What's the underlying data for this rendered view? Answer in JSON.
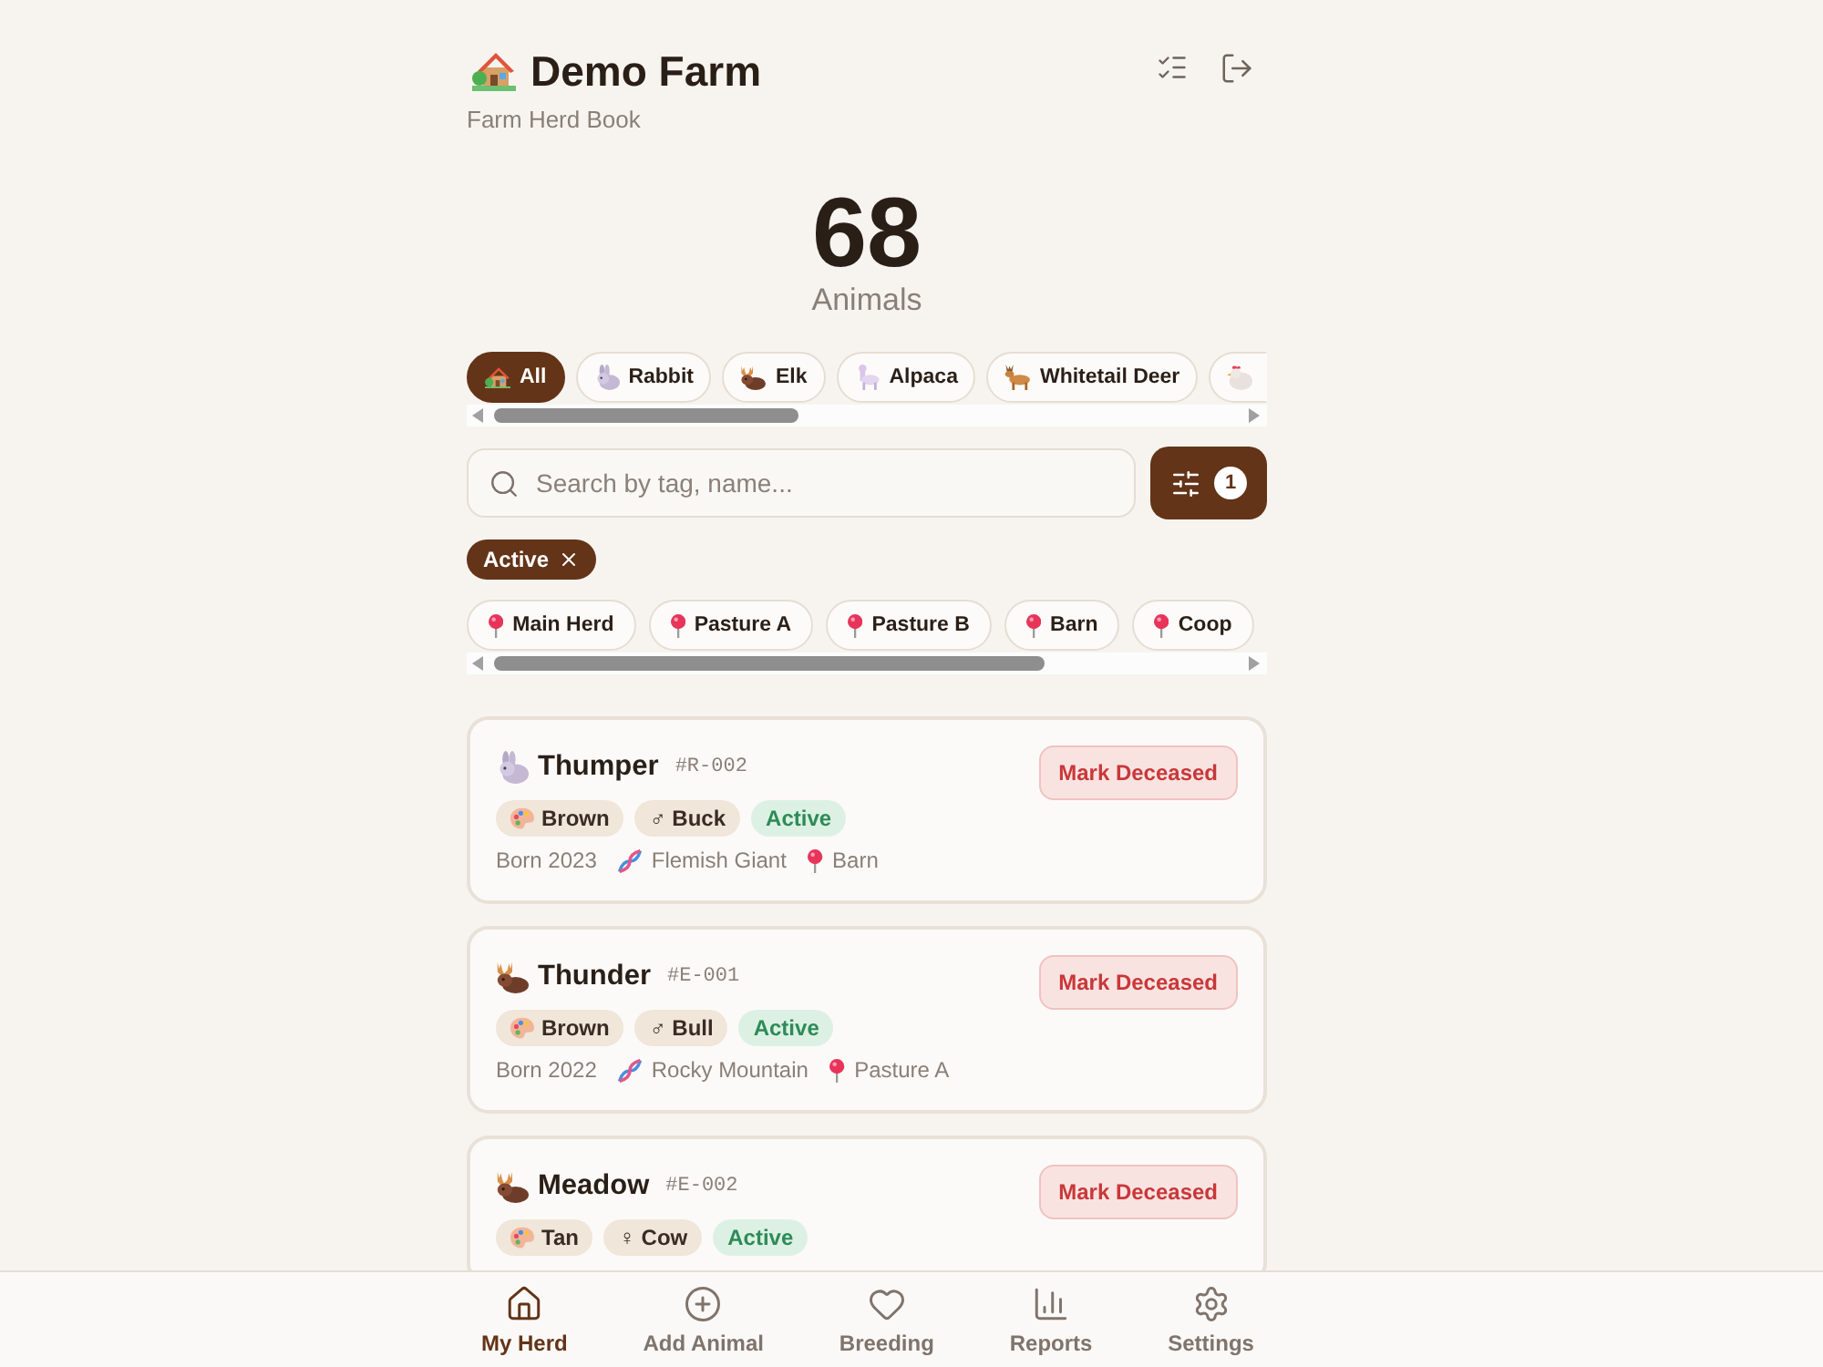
{
  "header": {
    "title": "Demo Farm",
    "subtitle": "Farm Herd Book"
  },
  "summary": {
    "count": "68",
    "label": "Animals"
  },
  "species_filters": [
    {
      "kind": "all",
      "label": "All",
      "selected": true
    },
    {
      "kind": "rabbit",
      "label": "Rabbit",
      "selected": false
    },
    {
      "kind": "elk",
      "label": "Elk",
      "selected": false
    },
    {
      "kind": "alpaca",
      "label": "Alpaca",
      "selected": false
    },
    {
      "kind": "deer",
      "label": "Whitetail Deer",
      "selected": false
    },
    {
      "kind": "chicken",
      "selected": false
    }
  ],
  "search": {
    "placeholder": "Search by tag, name..."
  },
  "filter_button": {
    "badge": "1"
  },
  "active_filters": [
    {
      "label": "Active"
    }
  ],
  "locations": [
    {
      "label": "Main Herd",
      "selected": false
    },
    {
      "label": "Pasture A",
      "selected": false
    },
    {
      "label": "Pasture B",
      "selected": false
    },
    {
      "label": "Barn",
      "selected": false
    },
    {
      "label": "Coop",
      "selected": false
    }
  ],
  "animals": [
    {
      "kind": "rabbit",
      "name": "Thumper",
      "tag": "#R-002",
      "tags": [
        {
          "kind": "color",
          "label": "Brown"
        },
        {
          "kind": "sex",
          "label": "♂ Buck"
        },
        {
          "kind": "status",
          "label": "Active"
        }
      ],
      "born": "Born 2023",
      "breed": "Flemish Giant",
      "location": "Barn",
      "action": "Mark Deceased"
    },
    {
      "kind": "elk",
      "name": "Thunder",
      "tag": "#E-001",
      "tags": [
        {
          "kind": "color",
          "label": "Brown"
        },
        {
          "kind": "sex",
          "label": "♂ Bull"
        },
        {
          "kind": "status",
          "label": "Active"
        }
      ],
      "born": "Born 2022",
      "breed": "Rocky Mountain",
      "location": "Pasture A",
      "action": "Mark Deceased"
    },
    {
      "kind": "elk",
      "name": "Meadow",
      "tag": "#E-002",
      "tags": [
        {
          "kind": "color",
          "label": "Tan"
        },
        {
          "kind": "sex",
          "label": "♀ Cow"
        },
        {
          "kind": "status",
          "label": "Active"
        }
      ],
      "action": "Mark Deceased"
    }
  ],
  "nav": [
    {
      "kind": "home",
      "label": "My Herd",
      "selected": true
    },
    {
      "kind": "add",
      "label": "Add Animal",
      "selected": false
    },
    {
      "kind": "breeding",
      "label": "Breeding",
      "selected": false
    },
    {
      "kind": "reports",
      "label": "Reports",
      "selected": false
    },
    {
      "kind": "settings",
      "label": "Settings",
      "selected": false
    }
  ]
}
